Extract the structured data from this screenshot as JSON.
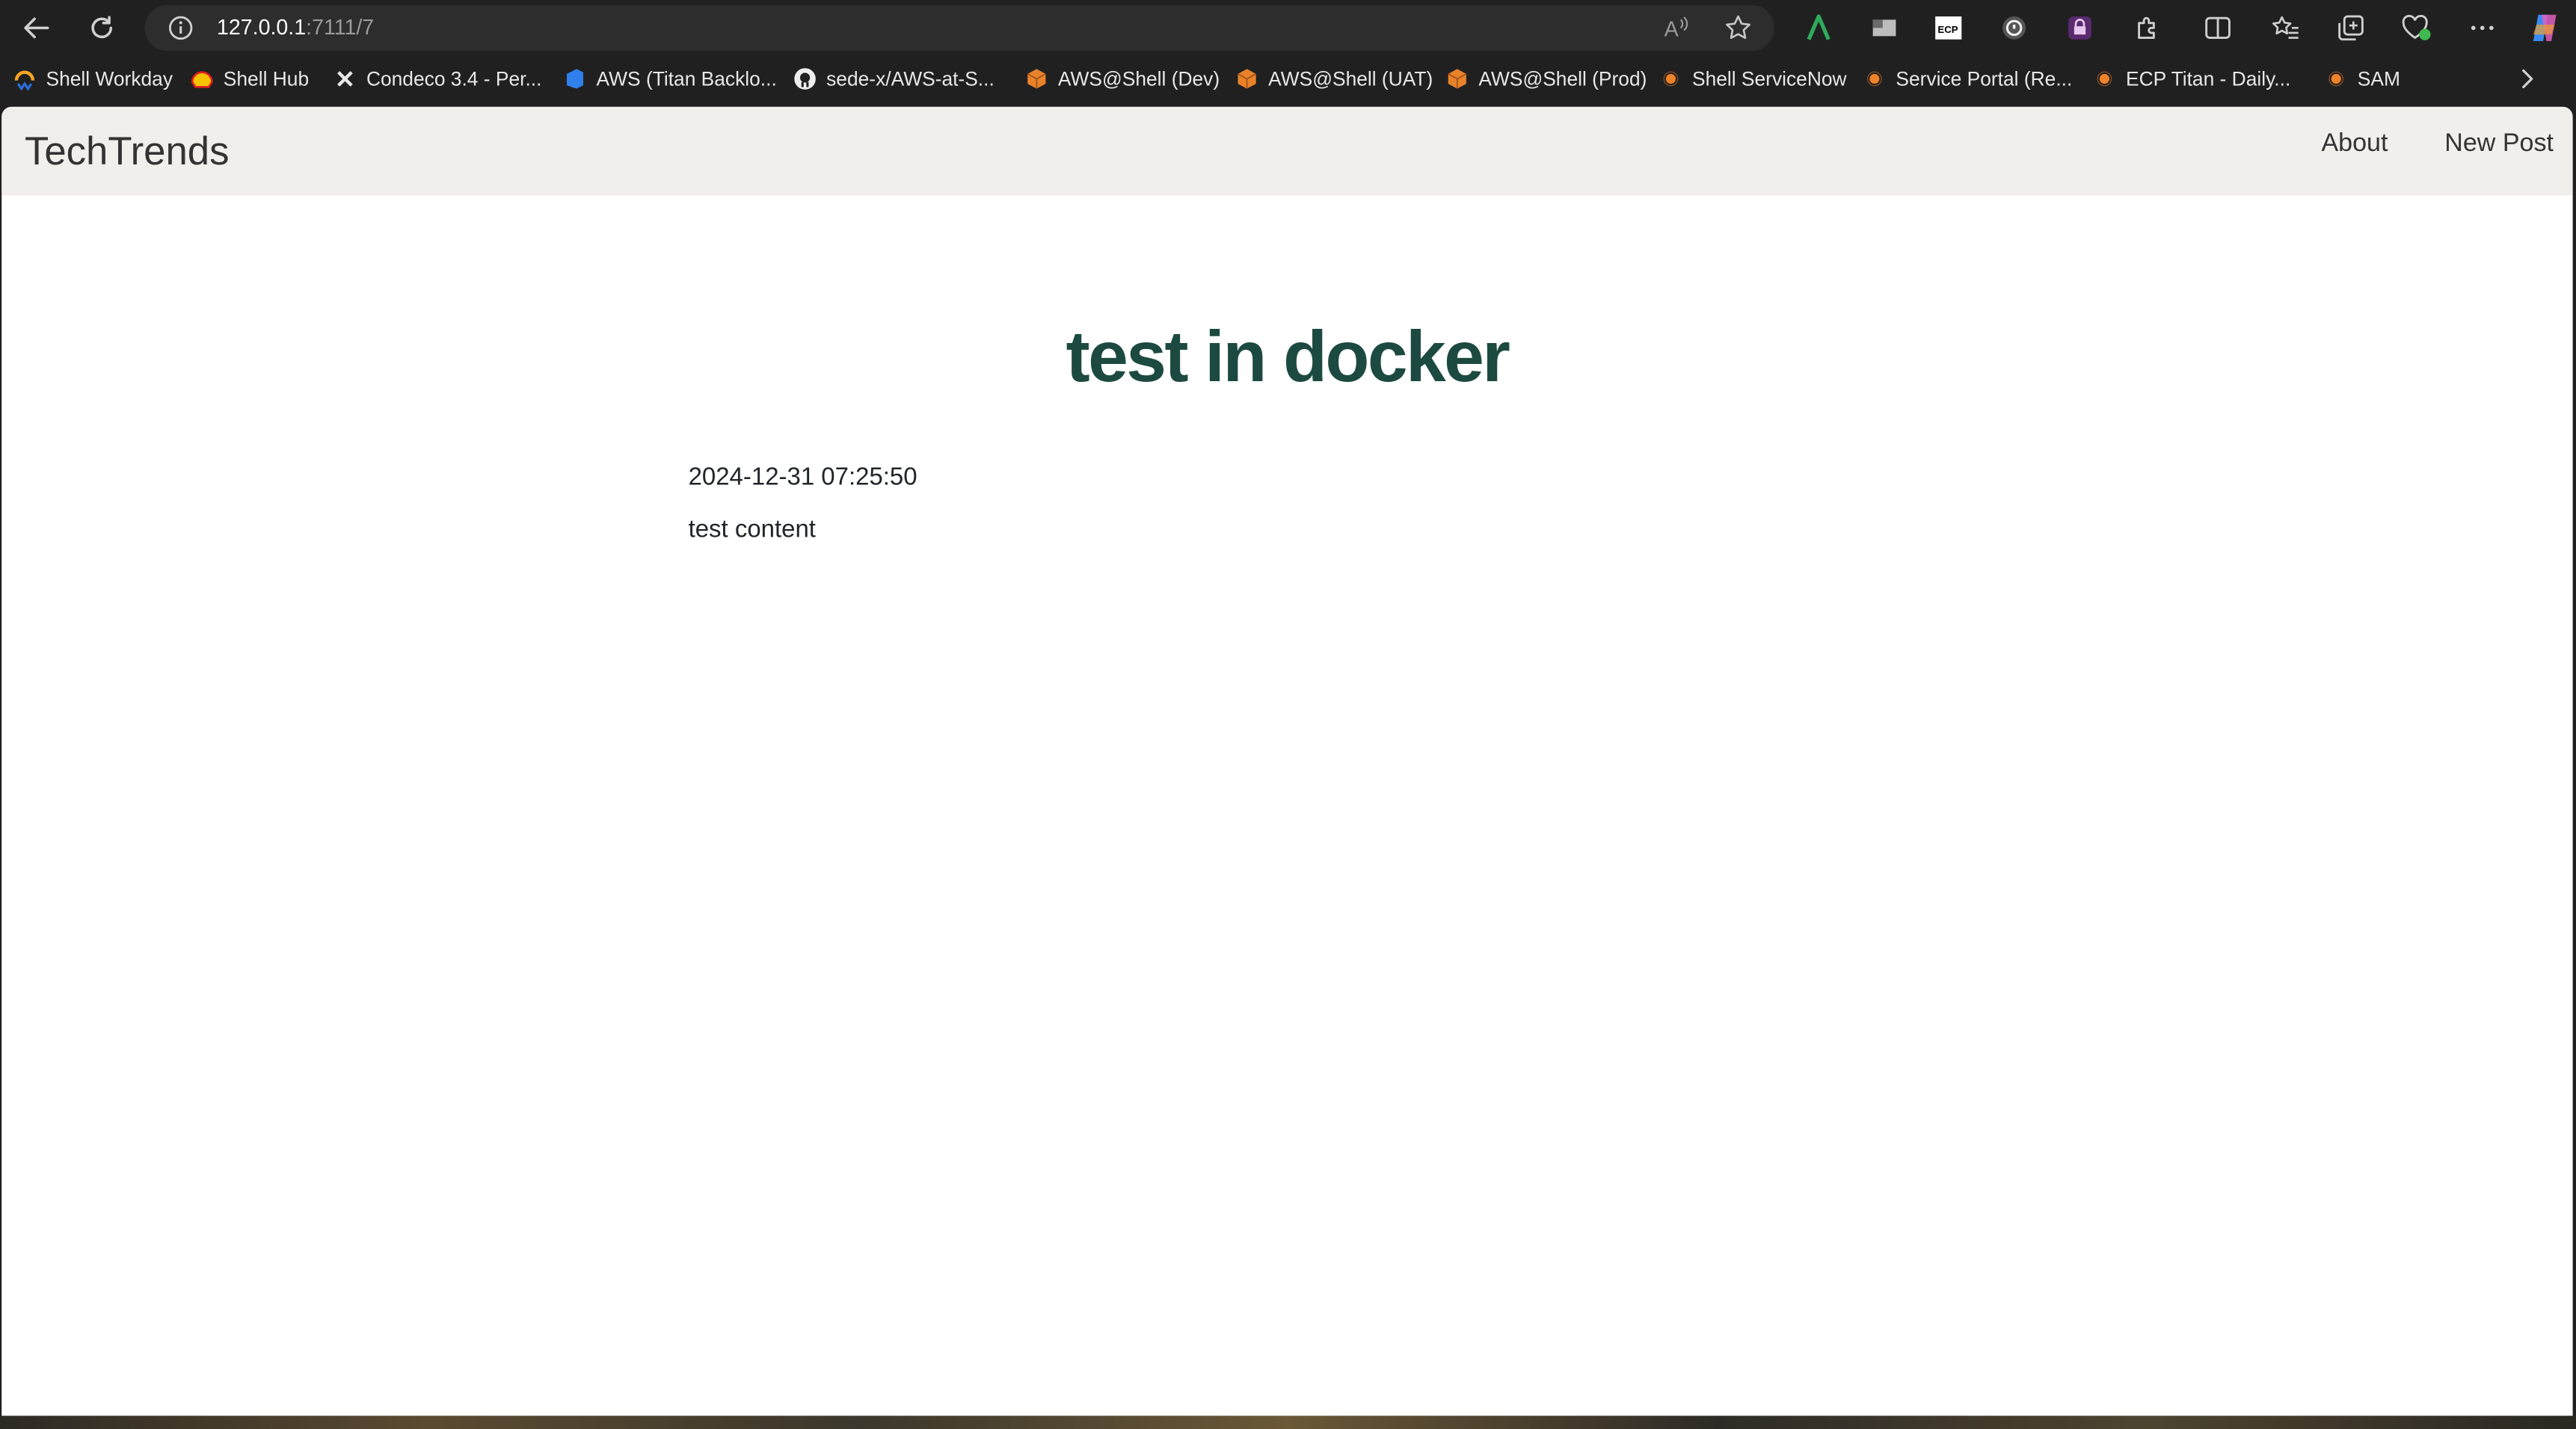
{
  "browser": {
    "url_host": "127.0.0.1",
    "url_path": ":7111/7",
    "icons": {
      "back": "back-arrow-icon",
      "reload": "reload-icon",
      "site_info": "info-icon",
      "read_aloud": "read-aloud-icon",
      "favorite": "star-icon"
    },
    "extension_icons": [
      "grammarly-icon",
      "flag-icon",
      "ecp-icon",
      "password-icon",
      "privacy-icon",
      "extensions-icon",
      "split-screen-icon",
      "favorites-icon",
      "collections-icon",
      "browser-essentials-icon",
      "more-icon",
      "copilot-icon"
    ],
    "bookmarks": [
      {
        "label": "Shell Workday",
        "icon": "workday-icon"
      },
      {
        "label": "Shell Hub",
        "icon": "shell-icon"
      },
      {
        "label": "Condeco 3.4 - Per...",
        "icon": "condeco-icon"
      },
      {
        "label": "AWS (Titan Backlo...",
        "icon": "azure-devops-icon"
      },
      {
        "label": "sede-x/AWS-at-S...",
        "icon": "github-icon"
      },
      {
        "label": "AWS@Shell (Dev)",
        "icon": "aws-box-icon"
      },
      {
        "label": "AWS@Shell (UAT)",
        "icon": "aws-box-icon"
      },
      {
        "label": "AWS@Shell (Prod)",
        "icon": "aws-box-icon"
      },
      {
        "label": "Shell ServiceNow",
        "icon": "servicenow-icon"
      },
      {
        "label": "Service Portal (Re...",
        "icon": "servicenow-icon"
      },
      {
        "label": "ECP Titan - Daily...",
        "icon": "servicenow-icon"
      },
      {
        "label": "SAM",
        "icon": "servicenow-icon"
      }
    ]
  },
  "site": {
    "brand": "TechTrends",
    "nav": {
      "about": "About",
      "new_post": "New Post"
    }
  },
  "post": {
    "title": "test in docker",
    "date": "2024-12-31 07:25:50",
    "content": "test content"
  },
  "colors": {
    "navbar_bg": "#f0efeb",
    "title": "#1d4a40",
    "chrome_bg": "#202020"
  }
}
